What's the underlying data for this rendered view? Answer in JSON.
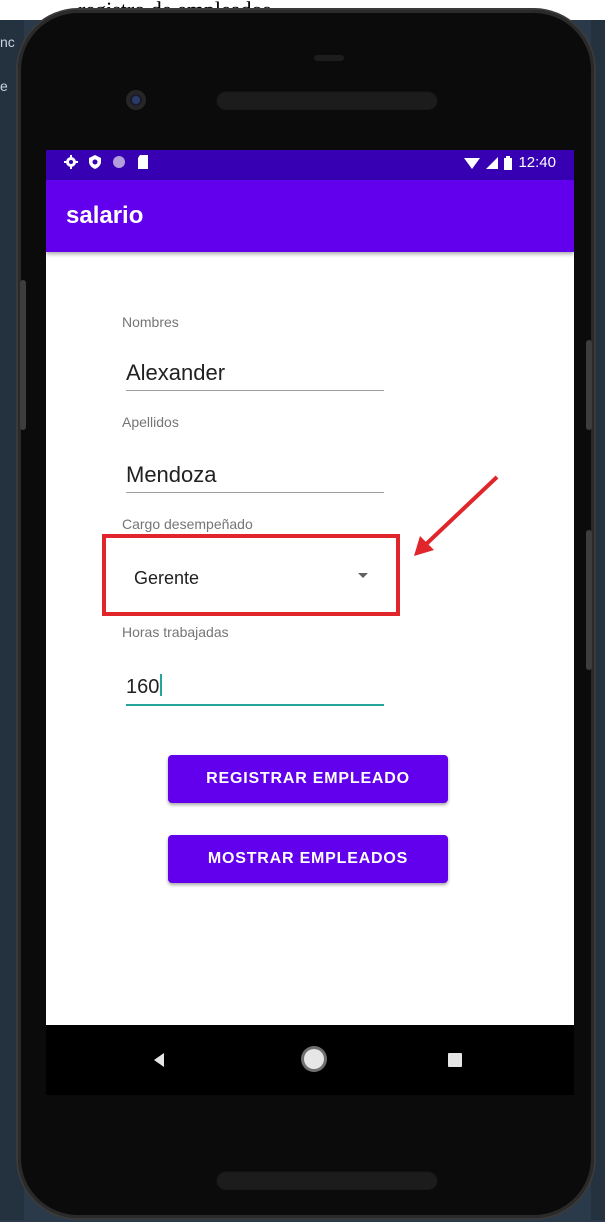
{
  "caption": {
    "text": "registro de empleados"
  },
  "status_bar": {
    "time": "12:40"
  },
  "app_bar": {
    "title": "salario"
  },
  "form": {
    "nombres": {
      "label": "Nombres",
      "value": "Alexander"
    },
    "apellidos": {
      "label": "Apellidos",
      "value": "Mendoza"
    },
    "cargo": {
      "label": "Cargo desempeñado",
      "selected": "Gerente"
    },
    "horas": {
      "label": "Horas trabajadas",
      "value": "160"
    }
  },
  "buttons": {
    "registrar": "REGISTRAR EMPLEADO",
    "mostrar": "MOSTRAR EMPLEADOS"
  },
  "colors": {
    "status_bar": "#3700b3",
    "app_bar": "#6200ee",
    "button": "#6200ee",
    "focus_underline": "#26a69a",
    "annotation_red": "#e0262a"
  },
  "icons": {
    "status_left": [
      "settings-icon",
      "shield-icon",
      "circle-icon",
      "sd-card-icon"
    ],
    "status_right": [
      "wifi-icon",
      "signal-icon",
      "battery-icon"
    ],
    "nav": [
      "back-icon",
      "home-icon",
      "recents-icon"
    ]
  }
}
